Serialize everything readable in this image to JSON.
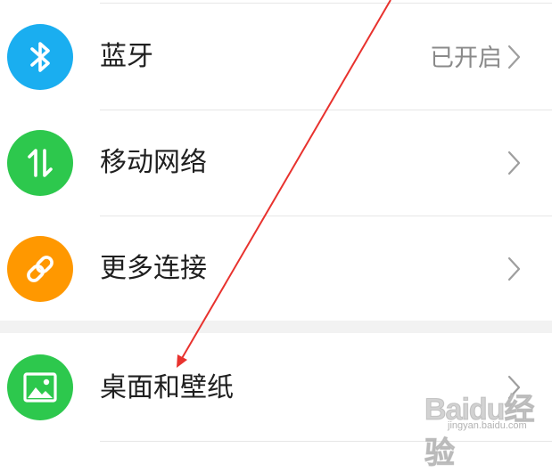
{
  "settings": {
    "items": [
      {
        "label": "蓝牙",
        "value": "已开启",
        "icon": "bluetooth-icon",
        "color": "#1aaef0"
      },
      {
        "label": "移动网络",
        "value": "",
        "icon": "mobile-data-arrows-icon",
        "color": "#2dc84d"
      },
      {
        "label": "更多连接",
        "value": "",
        "icon": "link-chain-icon",
        "color": "#ff9800"
      },
      {
        "label": "桌面和壁纸",
        "value": "",
        "icon": "wallpaper-image-icon",
        "color": "#2dc84d"
      }
    ]
  },
  "watermark": {
    "brand": "Baidu经验",
    "site": "jingyan.baidu.com"
  },
  "annotation": {
    "arrow_color": "#e8322e",
    "icon": "red-arrow-annotation"
  },
  "colors": {
    "divider": "#e6e6e6",
    "section_gap": "#f2f2f2",
    "label": "#1f1f1f",
    "value": "#8a8a8a",
    "chevron": "#9e9e9e"
  }
}
